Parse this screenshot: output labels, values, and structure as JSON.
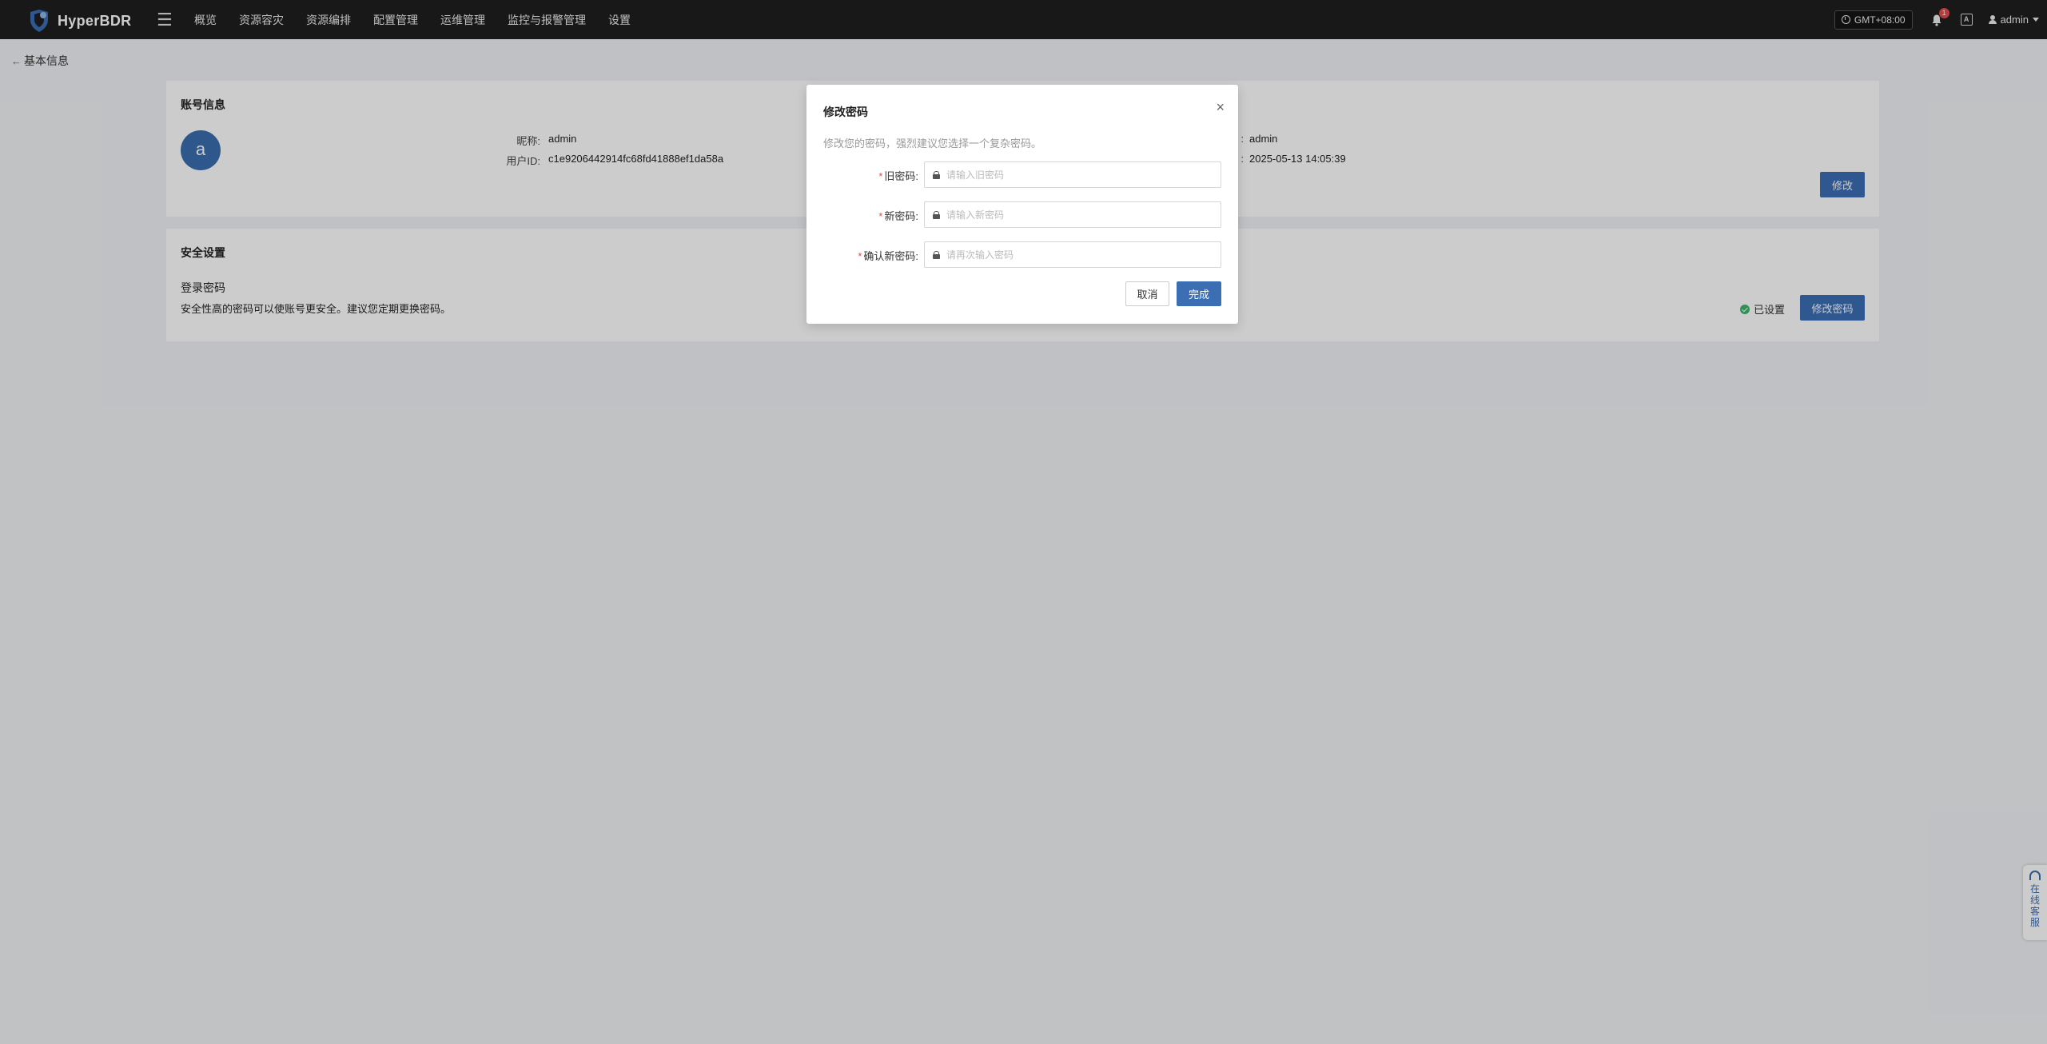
{
  "app": {
    "name": "HyperBDR"
  },
  "nav": [
    {
      "label": "概览"
    },
    {
      "label": "资源容灾"
    },
    {
      "label": "资源编排"
    },
    {
      "label": "配置管理"
    },
    {
      "label": "运维管理"
    },
    {
      "label": "监控与报警管理"
    },
    {
      "label": "设置"
    }
  ],
  "topbar": {
    "timezone": "GMT+08:00",
    "notification_count": "1",
    "lang_icon_text": "A",
    "user": "admin"
  },
  "page": {
    "back_label": "基本信息"
  },
  "account": {
    "title": "账号信息",
    "avatar_letter": "a",
    "nickname_label": "昵称:",
    "nickname_value": "admin",
    "userid_label": "用户ID:",
    "userid_value": "c1e9206442914fc68fd41888ef1da58a",
    "right_label_1": ":",
    "right_value_1": "admin",
    "right_label_2": ":",
    "right_value_2": "2025-05-13 14:05:39",
    "edit_button": "修改"
  },
  "security": {
    "title": "安全设置",
    "item_title": "登录密码",
    "item_desc": "安全性高的密码可以使账号更安全。建议您定期更换密码。",
    "status": "已设置",
    "change_button": "修改密码"
  },
  "modal": {
    "title": "修改密码",
    "close": "×",
    "desc": "修改您的密码，强烈建议您选择一个复杂密码。",
    "fields": [
      {
        "label": "旧密码:",
        "placeholder": "请输入旧密码"
      },
      {
        "label": "新密码:",
        "placeholder": "请输入新密码"
      },
      {
        "label": "确认新密码:",
        "placeholder": "请再次输入密码"
      }
    ],
    "required_mark": "*",
    "cancel": "取消",
    "ok": "完成"
  },
  "service_widget": {
    "label": "在线客服"
  },
  "colors": {
    "primary": "#3c6eb4",
    "topbar": "#1f1f1f",
    "success": "#3fb56b",
    "danger": "#e14b4b"
  },
  "icons": [
    "logo-shield-icon",
    "menu-icon",
    "clock-icon",
    "bell-icon",
    "language-icon",
    "user-icon",
    "caret-down-icon",
    "back-arrow-icon",
    "check-circle-icon",
    "lock-icon",
    "close-icon",
    "headset-icon"
  ]
}
